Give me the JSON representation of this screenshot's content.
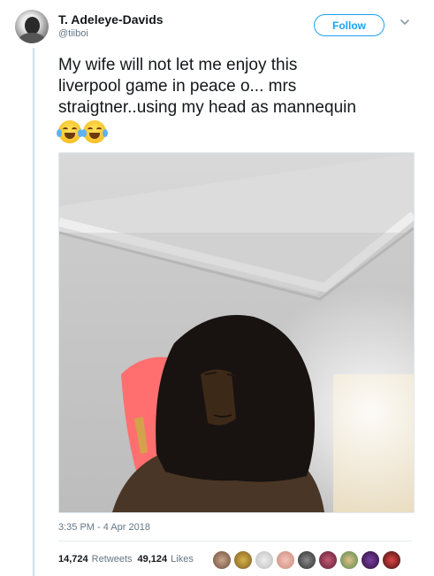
{
  "author": {
    "name": "T. Adeleye-Davids",
    "handle": "@tiiboi"
  },
  "follow_label": "Follow",
  "tweet": {
    "line1": "My wife will not let me enjoy this",
    "line2": "liverpool game in peace o... mrs",
    "line3": "straigtner..using my head as mannequin",
    "emoji": [
      "face-with-tears-of-joy",
      "face-with-tears-of-joy"
    ]
  },
  "timestamp": "3:35 PM - 4 Apr 2018",
  "stats": {
    "retweets_count": "14,724",
    "retweets_label": "Retweets",
    "likes_count": "49,124",
    "likes_label": "Likes"
  },
  "colors": {
    "accent": "#1da1f2",
    "secondary_text": "#657786",
    "thread_line": "#c4e3f7"
  },
  "liker_avatars": [
    "avatar-1",
    "avatar-2",
    "avatar-3",
    "avatar-4",
    "avatar-5",
    "avatar-6",
    "avatar-7",
    "avatar-8",
    "avatar-9"
  ]
}
